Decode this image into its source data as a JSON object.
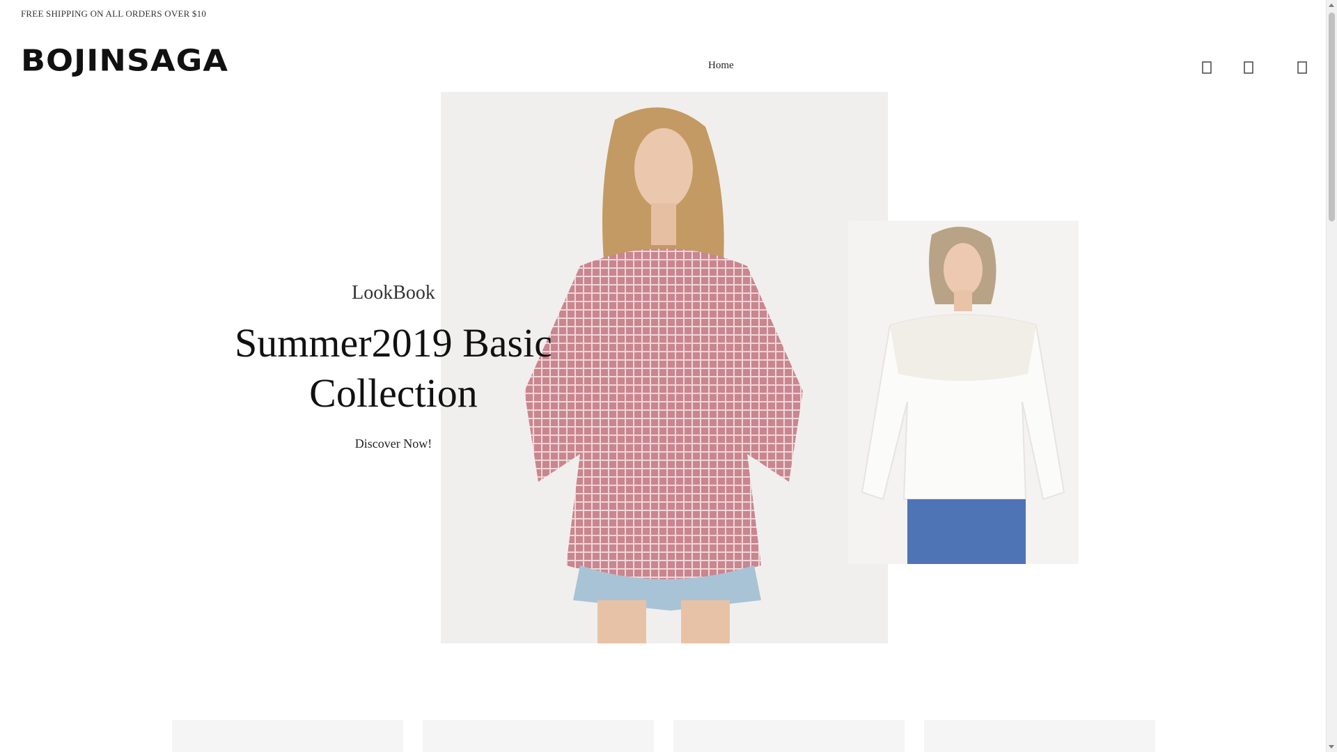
{
  "announcement": "FREE SHIPPING ON ALL ORDERS OVER $10",
  "brand": {
    "logo_text": "BOJINSAGA"
  },
  "nav": {
    "items": [
      {
        "label": "Home"
      }
    ]
  },
  "header_icons": [
    "search-icon",
    "account-icon",
    "cart-icon"
  ],
  "hero": {
    "kicker": "LookBook",
    "headline_line1": "Summer2019 Basic",
    "headline_line2": "Collection",
    "cta_label": "Discover Now!"
  },
  "colors": {
    "text": "#222222",
    "tile_placeholder": "#f5f5f5",
    "gingham": "#c9868f"
  }
}
